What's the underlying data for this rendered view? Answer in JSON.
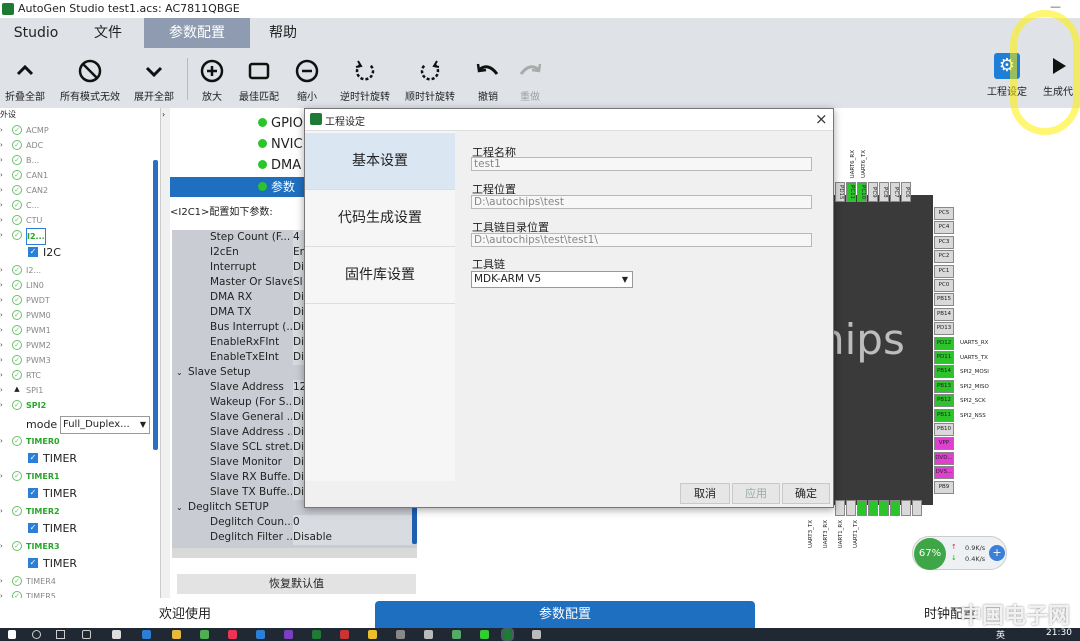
{
  "window": {
    "title": "AutoGen Studio test1.acs: AC7811QBGE",
    "minimize": "—"
  },
  "menu": [
    "Studio",
    "文件",
    "参数配置",
    "帮助"
  ],
  "toolbar": {
    "collapse_all": "折叠全部",
    "all_modes_invalid": "所有模式无效",
    "expand_all": "展开全部",
    "zoom_in": "放大",
    "best_fit": "最佳匹配",
    "zoom_out": "缩小",
    "rotate_ccw": "逆时针旋转",
    "rotate_cw": "顺时针旋转",
    "undo": "撤销",
    "redo": "重做",
    "project_settings": "工程设定",
    "generate_code": "生成代"
  },
  "tree": {
    "header": "外设",
    "items": [
      {
        "name": "ACMP",
        "active": false
      },
      {
        "name": "ADC",
        "active": false
      },
      {
        "name": "B...",
        "active": false
      },
      {
        "name": "CAN1",
        "active": false
      },
      {
        "name": "CAN2",
        "active": false
      },
      {
        "name": "C...",
        "active": false
      },
      {
        "name": "CTU",
        "active": false
      },
      {
        "name": "I2...",
        "active": true
      }
    ],
    "i2c_child": "I2C",
    "items2": [
      {
        "name": "I2...",
        "active": false
      },
      {
        "name": "LIN0",
        "active": false
      },
      {
        "name": "PWDT",
        "active": false
      },
      {
        "name": "PWM0",
        "active": false
      },
      {
        "name": "PWM1",
        "active": false
      },
      {
        "name": "PWM2",
        "active": false
      },
      {
        "name": "PWM3",
        "active": false
      },
      {
        "name": "RTC",
        "active": false
      },
      {
        "name": "SPI1",
        "active": false,
        "warn": true
      },
      {
        "name": "SPI2",
        "active": true
      }
    ],
    "mode_label": "mode",
    "mode_value": "Full_Duplex...",
    "timers": [
      {
        "name": "TIMER0",
        "child": "TIMER"
      },
      {
        "name": "TIMER1",
        "child": "TIMER"
      },
      {
        "name": "TIMER2",
        "child": "TIMER"
      },
      {
        "name": "TIMER3",
        "child": "TIMER"
      }
    ],
    "tail": [
      "TIMER4",
      "TIMER5"
    ]
  },
  "groups": [
    "GPIO",
    "NVIC",
    "DMA",
    "参数"
  ],
  "config_caption": "<I2C1>配置如下参数:",
  "params": [
    {
      "k": "Step Count (F...",
      "v": "4"
    },
    {
      "k": "I2cEn",
      "v": "En"
    },
    {
      "k": "Interrupt",
      "v": "Di"
    },
    {
      "k": "Master Or Slave",
      "v": "Sl"
    },
    {
      "k": "DMA RX",
      "v": "Di"
    },
    {
      "k": "DMA TX",
      "v": "Di"
    },
    {
      "k": "Bus Interrupt (...",
      "v": "Di"
    },
    {
      "k": "EnableRxFInt",
      "v": "Di"
    },
    {
      "k": "EnableTxEInt",
      "v": "Di"
    }
  ],
  "slave_section": "Slave Setup",
  "slave_params": [
    {
      "k": "Slave Address",
      "v": "12"
    },
    {
      "k": "Wakeup (For S...",
      "v": "Di"
    },
    {
      "k": "Slave General ...",
      "v": "Di"
    },
    {
      "k": "Slave Address ...",
      "v": "Di"
    },
    {
      "k": "Slave SCL stret...",
      "v": "Di"
    },
    {
      "k": "Slave Monitor",
      "v": "Di"
    },
    {
      "k": "Slave RX Buffe...",
      "v": "Di"
    },
    {
      "k": "Slave TX Buffe...",
      "v": "Di"
    }
  ],
  "deglitch_section": "Deglitch SETUP",
  "deglitch_params": [
    {
      "k": "Deglitch Coun...",
      "v": "0"
    },
    {
      "k": "Deglitch Filter ...",
      "v": "Disable"
    }
  ],
  "restore_default": "恢复默认值",
  "chip": {
    "brand_text": "hips",
    "top_pins": [
      "PD15",
      "PC11",
      "PC10",
      "PC9",
      "PC8",
      "PC7",
      "PC6"
    ],
    "top_labels": [
      "UART6_RX",
      "UART6_TX"
    ],
    "right_pins": [
      "PC5",
      "PC4",
      "PC3",
      "PC2",
      "PC1",
      "PC0",
      "PB15",
      "PB14",
      "PD13",
      "PD12",
      "PD11",
      "PB14",
      "PB13",
      "PB12",
      "PB11",
      "PB10",
      "VPP",
      "DVD...",
      "DVS...",
      "PB9"
    ],
    "right_labels": [
      "UART5_RX",
      "UART5_TX",
      "SPI2_MOSI",
      "SPI2_MISO",
      "SPI2_SCK",
      "SPI2_NSS"
    ],
    "bottom_labels": [
      "UART3_TX",
      "UART3_RX",
      "UART1_RX",
      "UART1_TX"
    ]
  },
  "dialog": {
    "title": "工程设定",
    "close": "×",
    "nav": [
      "基本设置",
      "代码生成设置",
      "固件库设置"
    ],
    "fields": [
      {
        "label": "工程名称",
        "value": "test1"
      },
      {
        "label": "工程位置",
        "value": "D:\\autochips\\test"
      },
      {
        "label": "工具链目录位置",
        "value": "D:\\autochips\\test\\test1\\"
      }
    ],
    "toolchain_label": "工具链",
    "toolchain_value": "MDK-ARM V5",
    "buttons": {
      "cancel": "取消",
      "apply": "应用",
      "ok": "确定"
    }
  },
  "bottom_tabs": [
    "欢迎使用",
    "参数配置",
    "时钟配置"
  ],
  "net_widget": {
    "percent": "67%",
    "up": "0.9K/s",
    "down": "0.4K/s"
  },
  "taskbar": {
    "time": "21:30",
    "ime": "英"
  },
  "watermark": "中国电子网",
  "colors": {
    "accent": "#1f6fc0",
    "green": "#2bc42b",
    "toolbar": "#dfe3e8",
    "active_menu": "#8e9bb0"
  }
}
